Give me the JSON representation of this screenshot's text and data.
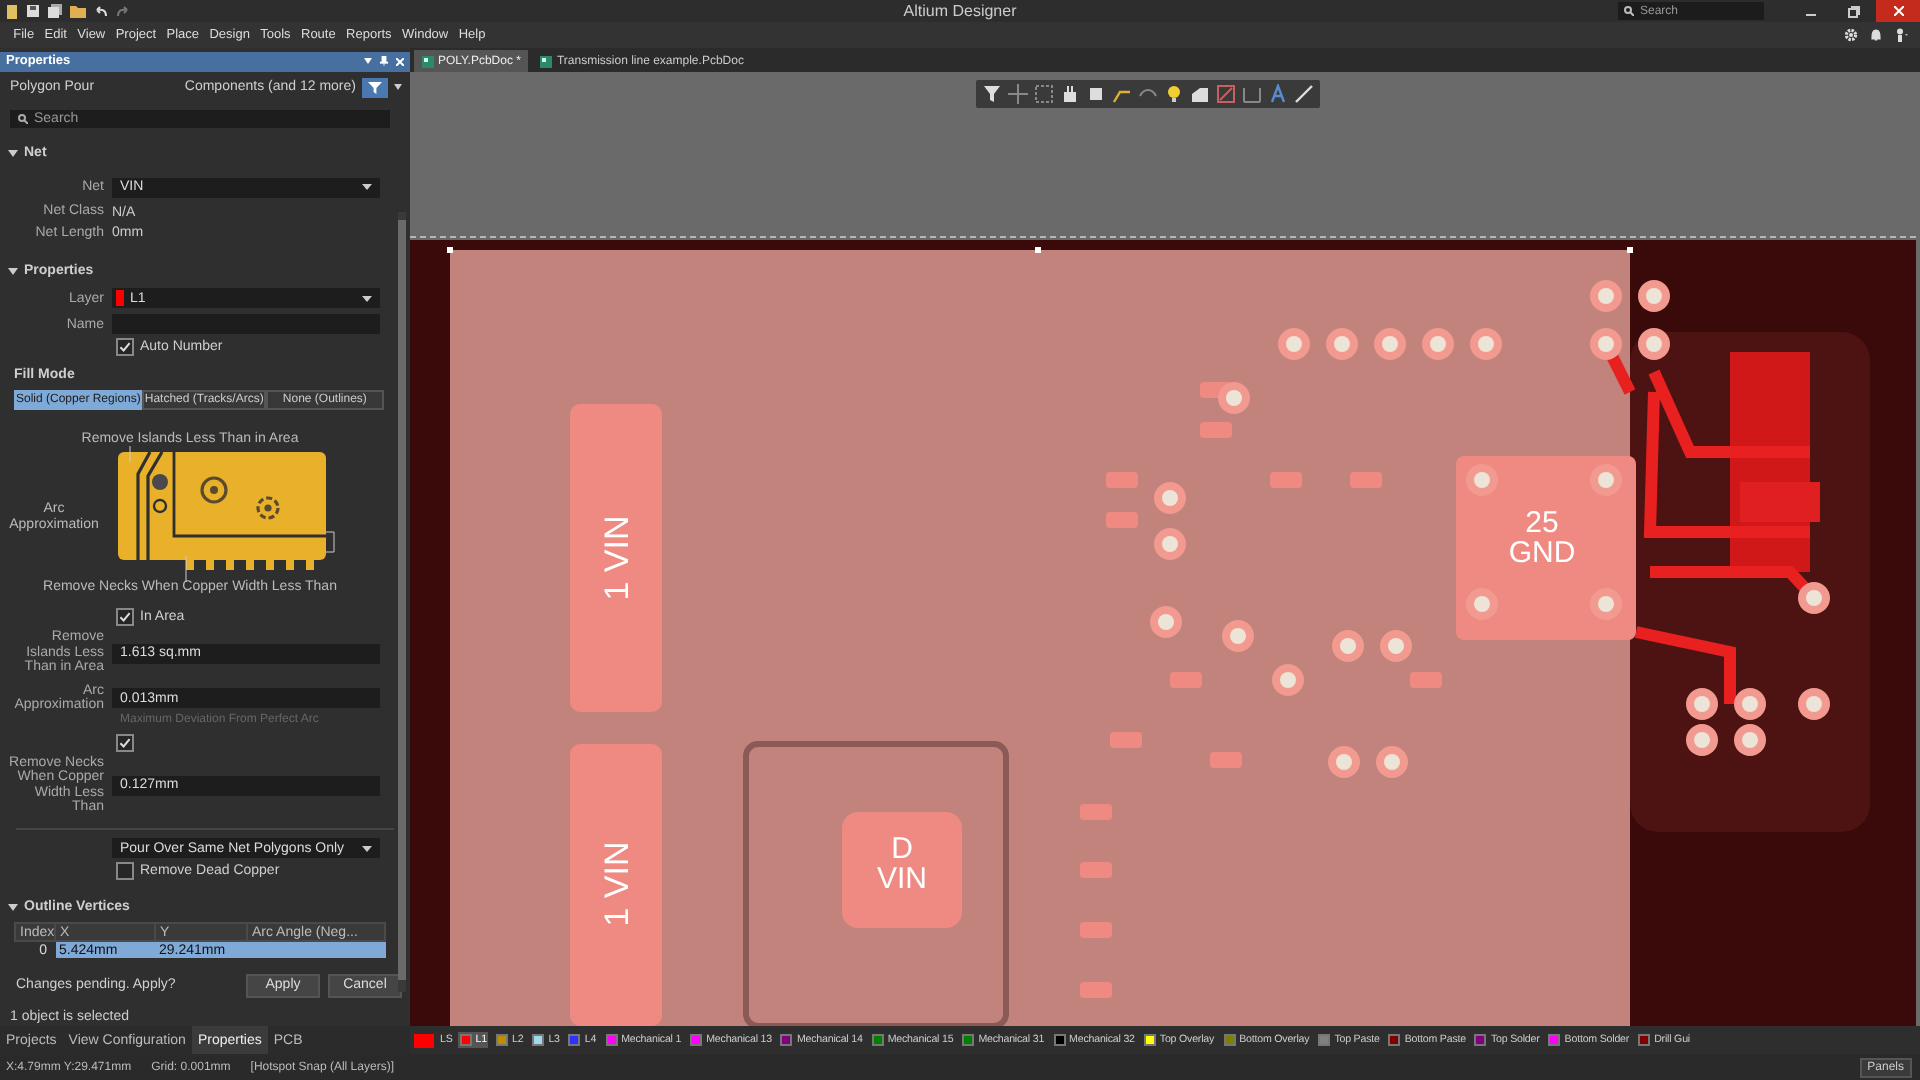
{
  "title_bar": {
    "title": "Altium Designer",
    "search": {
      "placeholder": "Search"
    }
  },
  "menu": [
    "File",
    "Edit",
    "View",
    "Project",
    "Place",
    "Design",
    "Tools",
    "Route",
    "Reports",
    "Window",
    "Help"
  ],
  "documents": {
    "tabs": [
      {
        "label": "POLY.PcbDoc *",
        "selected": true
      },
      {
        "label": "Transmission line example.PcbDoc",
        "selected": false
      }
    ]
  },
  "properties": {
    "title": "Properties",
    "object_type": "Polygon Pour",
    "filter": "Components (and 12 more)",
    "search": {
      "placeholder": "Search"
    },
    "net_section": {
      "title": "Net",
      "expanded": true,
      "net_label": "Net",
      "net": "VIN",
      "net_class_label": "Net Class",
      "net_class": "N/A",
      "net_length_label": "Net Length",
      "net_length": "0mm"
    },
    "properties_section": {
      "title": "Properties",
      "expanded": true,
      "layer_label": "Layer",
      "layer": "L1",
      "layer_swatch": {
        "color": "#ff0000"
      },
      "name_label": "Name",
      "auto_number": {
        "label": "Auto Number",
        "checked": true
      }
    },
    "fill_mode": {
      "title": "Fill Mode",
      "options": [
        {
          "label": "Solid (Copper Regions)",
          "selected": true
        },
        {
          "label": "Hatched (Tracks/Arcs)",
          "selected": false
        },
        {
          "label": "None (Outlines)",
          "selected": false
        }
      ]
    },
    "diagram": {
      "top_label": "Remove Islands Less Than in Area",
      "side_label": "Arc Approximation",
      "bottom_label": "Remove Necks When Copper Width Less Than"
    },
    "in_area": {
      "label": "In Area",
      "checked": true
    },
    "remove_islands": {
      "label": "Remove Islands Less Than in Area",
      "value": "1.613 sq.mm"
    },
    "arc_approximation": {
      "label": "Arc Approximation",
      "value": "0.013mm",
      "hint": "Maximum Deviation From Perfect Arc"
    },
    "remove_necks_enabled": {
      "checked": true
    },
    "remove_necks": {
      "label": "Remove Necks When Copper Width Less Than",
      "value": "0.127mm"
    },
    "pour_over": "Pour Over Same Net Polygons Only",
    "remove_dead_copper": {
      "label": "Remove Dead Copper",
      "checked": false
    },
    "outline_vertices": {
      "title": "Outline Vertices",
      "expanded": true,
      "columns": [
        "Index",
        "X",
        "Y",
        "Arc Angle (Neg..."
      ],
      "rows": [
        {
          "cells": [
            "0",
            "5.424mm",
            "29.241mm"
          ],
          "selected": true
        }
      ]
    },
    "pending": "Changes pending. Apply?",
    "buttons": [
      "Apply",
      "Cancel"
    ],
    "selection_status": "1 object is selected"
  },
  "panel_tabs": [
    {
      "label": "Projects",
      "selected": false
    },
    {
      "label": "View Configuration",
      "selected": false
    },
    {
      "label": "Properties",
      "selected": true
    },
    {
      "label": "PCB",
      "selected": false
    }
  ],
  "canvas": {
    "labels": [
      {
        "kind": "vertical",
        "text": "1 VIN"
      },
      {
        "kind": "vertical",
        "text": "1 VIN"
      },
      {
        "kind": "stacked",
        "lines": [
          "25",
          "GND"
        ]
      },
      {
        "kind": "stacked",
        "lines": [
          "D",
          "VIN"
        ]
      }
    ]
  },
  "layer_bar": {
    "current": {
      "label": "LS",
      "color": "#ff0000"
    },
    "layers": [
      {
        "label": "L1",
        "color": "#ff0000",
        "selected": true
      },
      {
        "label": "L2",
        "color": "#bc8e00",
        "selected": false
      },
      {
        "label": "L3",
        "color": "#a0d8ef",
        "selected": false
      },
      {
        "label": "L4",
        "color": "#3030ff",
        "selected": false
      },
      {
        "label": "Mechanical 1",
        "color": "#ff00ff",
        "selected": false
      },
      {
        "label": "Mechanical 13",
        "color": "#ff00ff",
        "selected": false
      },
      {
        "label": "Mechanical 14",
        "color": "#800080",
        "selected": false
      },
      {
        "label": "Mechanical 15",
        "color": "#008000",
        "selected": false
      },
      {
        "label": "Mechanical 31",
        "color": "#008000",
        "selected": false
      },
      {
        "label": "Mechanical 32",
        "color": "#000000",
        "selected": false
      },
      {
        "label": "Top Overlay",
        "color": "#ffff00",
        "selected": false
      },
      {
        "label": "Bottom Overlay",
        "color": "#808000",
        "selected": false
      },
      {
        "label": "Top Paste",
        "color": "#808080",
        "selected": false
      },
      {
        "label": "Bottom Paste",
        "color": "#800000",
        "selected": false
      },
      {
        "label": "Top Solder",
        "color": "#800080",
        "selected": false
      },
      {
        "label": "Bottom Solder",
        "color": "#ff00ff",
        "selected": false
      },
      {
        "label": "Drill Gui",
        "color": "#800000",
        "selected": false
      }
    ]
  },
  "status_bar": {
    "coordinates": "X:4.79mm Y:29.471mm",
    "grid": "Grid: 0.001mm",
    "snap": "[Hotspot Snap (All Layers)]",
    "panels_button": "Panels"
  }
}
